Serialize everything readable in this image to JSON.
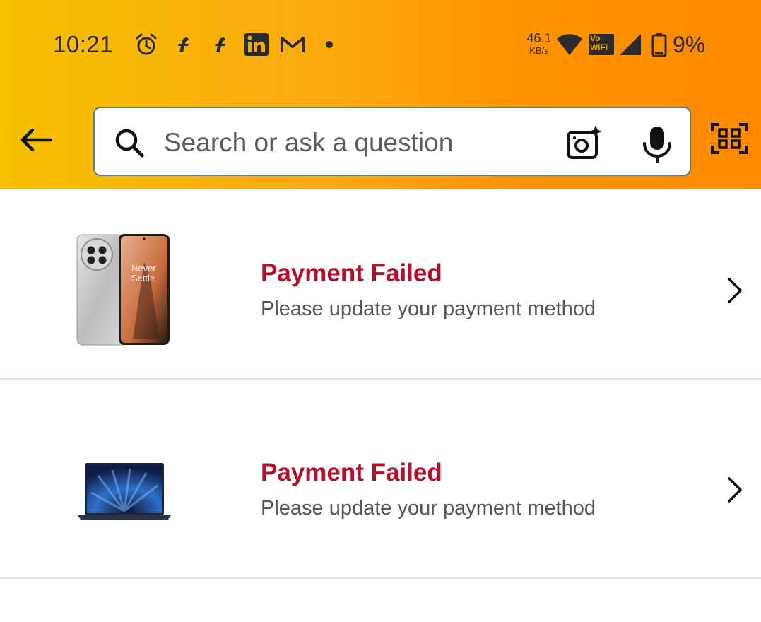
{
  "status_bar": {
    "time": "10:21",
    "notification_icons": [
      "alarm-icon",
      "flipkart-icon",
      "flipkart-icon",
      "linkedin-icon",
      "gmail-icon",
      "more-dot-icon"
    ],
    "network_speed_value": "46.1",
    "network_speed_unit": "KB/s",
    "vowifi_line1": "Vo",
    "vowifi_line2": "WiFi",
    "battery_percent": "9%"
  },
  "header": {
    "back_icon": "arrow-left-icon",
    "search": {
      "placeholder": "Search or ask a question",
      "value": ""
    },
    "camera_icon": "camera-sparkle-icon",
    "mic_icon": "microphone-icon",
    "scan_icon": "qr-scan-icon",
    "gradient_colors": [
      "#f7c000",
      "#ff8a00"
    ]
  },
  "orders": [
    {
      "thumbnail": "phone-product-image",
      "thumbnail_text_1": "Never",
      "thumbnail_text_2": "Settle",
      "title": "Payment Failed",
      "subtitle": "Please update your payment method"
    },
    {
      "thumbnail": "laptop-product-image",
      "title": "Payment Failed",
      "subtitle": "Please update your payment method"
    }
  ],
  "colors": {
    "alert_title": "#b1102b",
    "subtitle": "#565656",
    "divider": "#e1e1e1"
  }
}
